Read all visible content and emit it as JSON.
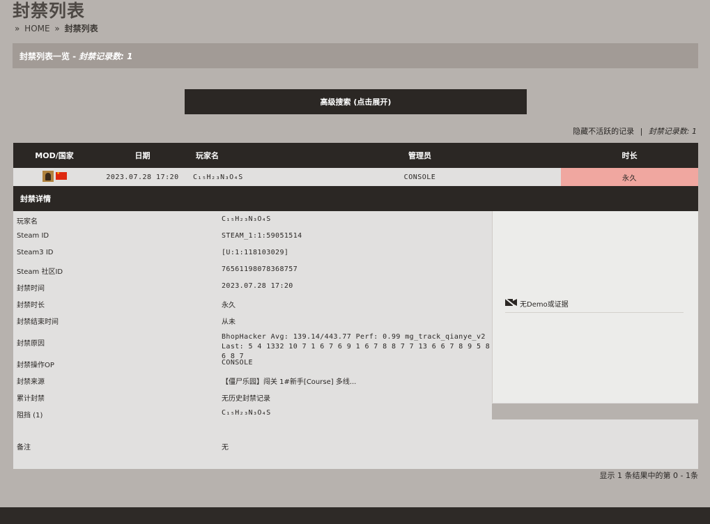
{
  "header": {
    "title": "封禁列表",
    "breadcrumb": {
      "home": "HOME",
      "current": "封禁列表",
      "sep": "»"
    }
  },
  "list_header": {
    "title": "封禁列表一览 -",
    "count": "封禁记录数: 1"
  },
  "advanced_search": {
    "label": "高级搜索 (点击展开)"
  },
  "toolbar": {
    "hide_inactive": "隐藏不活跃的记录",
    "separator": "|",
    "record_count": "封禁记录数: 1"
  },
  "table": {
    "columns": [
      "MOD/国家",
      "日期",
      "玩家名",
      "管理员",
      "时长"
    ],
    "rows": [
      {
        "mod_icon": "game-mod-icon",
        "country_flag": "china-flag-icon",
        "date": "2023.07.28 17:20",
        "player": "C₁₅H₂₃N₃O₄S",
        "admin": "CONSOLE",
        "length": "永久"
      }
    ]
  },
  "detail": {
    "title": "封禁详情",
    "fields": [
      {
        "key": "玩家名",
        "value": "C₁₅H₂₃N₃O₄S"
      },
      {
        "key": "Steam ID",
        "value": "STEAM_1:1:59051514"
      },
      {
        "key": "Steam3 ID",
        "value": "[U:1:118103029]"
      },
      {
        "key": "Steam 社区ID",
        "value": "76561198078368757"
      },
      {
        "key": "封禁时间",
        "value": "2023.07.28 17:20"
      },
      {
        "key": "封禁时长",
        "value": "永久"
      },
      {
        "key": "封禁结束时间",
        "value": "从未"
      },
      {
        "key": "封禁原因",
        "value": "BhopHacker Avg: 139.14/443.77 Perf: 0.99 mg_track_qianye_v2",
        "value2": "Last: 5 4 1332 10 7 1 6 7 6 9 1 6 7 8 8 7 7 13 6 6 7 8 9 5 8 6 8 7"
      },
      {
        "key": "封禁操作OP",
        "value": "CONSOLE"
      },
      {
        "key": "封禁来源",
        "value": "【僵尸乐园】闯关 1#新手[Course] 多线..."
      },
      {
        "key": "累计封禁",
        "value": "无历史封禁记录"
      },
      {
        "key": "阻挡 (1)",
        "value": "C₁₅H₂₃N₃O₄S"
      },
      {
        "key": "备注",
        "value": "无"
      }
    ],
    "demo": {
      "icon": "no-video-icon",
      "label": "无Demo或证据"
    }
  },
  "pager": {
    "text": "显示 1 条结果中的第 0 - 1条"
  }
}
